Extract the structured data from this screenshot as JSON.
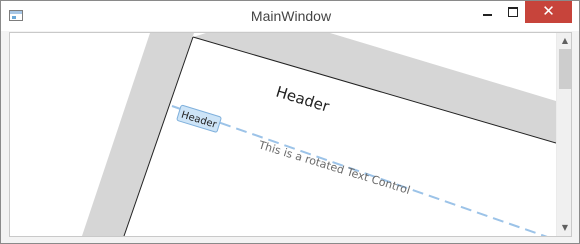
{
  "window": {
    "title": "MainWindow",
    "close_glyph": "✕"
  },
  "canvas": {
    "header_large": "Header",
    "header_small": "Header",
    "rotated_text": "This is a rotated Text Control"
  },
  "scrollbar": {
    "up_glyph": "▲",
    "down_glyph": "▼"
  },
  "colors": {
    "band": "#d6d6d6",
    "dashed_line": "#9cc3e8",
    "header_fill": "#cde4f7",
    "header_border": "#7fb0dc",
    "rotated_text_color": "#6a6a6a",
    "close_button": "#c7443b"
  }
}
